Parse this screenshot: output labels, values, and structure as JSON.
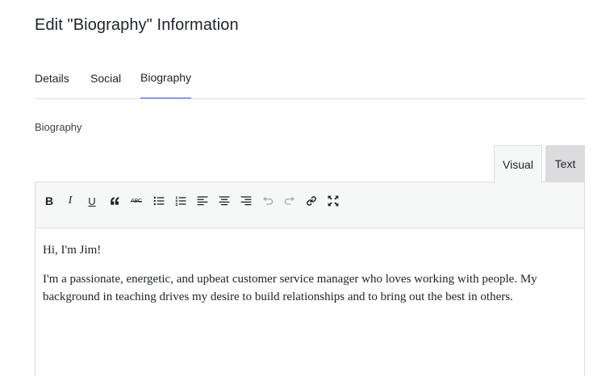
{
  "page": {
    "title": "Edit \"Biography\" Information"
  },
  "tabs": [
    {
      "label": "Details"
    },
    {
      "label": "Social"
    },
    {
      "label": "Biography"
    }
  ],
  "active_tab": "Biography",
  "field": {
    "label": "Biography"
  },
  "editor": {
    "modes": {
      "visual": "Visual",
      "text": "Text"
    },
    "active_mode": "Visual",
    "toolbar": {
      "bold": "B",
      "italic": "I",
      "underline": "U",
      "blockquote": "66",
      "strikethrough": "ABC"
    },
    "content": {
      "greeting": "Hi, I'm Jim!",
      "body": "I'm a passionate, energetic, and upbeat customer service manager who loves working with people. My background in teaching drives my desire to build relationships and to bring out the best in others."
    }
  },
  "colors": {
    "accent": "#3858e9",
    "border": "#dcdcde",
    "toolbar_bg": "#f6f7f7"
  }
}
